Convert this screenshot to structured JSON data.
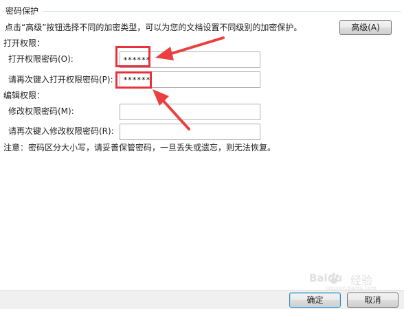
{
  "group": {
    "title": "密码保护"
  },
  "description": "点击“高级”按钮选择不同的加密类型，可以为您的文档设置不同级别的加密保护。",
  "advanced_button": {
    "label": "高级(A)"
  },
  "open_section": {
    "title": "打开权限：",
    "password_label": "打开权限密码(O):",
    "password_value": "******",
    "confirm_label": "请再次键入打开权限密码(P):",
    "confirm_value": "******"
  },
  "edit_section": {
    "title": "编辑权限：",
    "password_label": "修改权限密码(M):",
    "password_value": "",
    "confirm_label": "请再次键入修改权限密码(R):",
    "confirm_value": ""
  },
  "notice": "注意：密码区分大小写，请妥善保管密码，一旦丢失或遗忘，则无法恢复。",
  "footer": {
    "ok_label": "确定",
    "cancel_label": "取消"
  },
  "watermark": {
    "brand": "Baidu",
    "text": "经验",
    "url": "jingyan.baidu.com"
  },
  "colors": {
    "highlight": "#e8313a",
    "arrow": "#ec3f3f"
  }
}
